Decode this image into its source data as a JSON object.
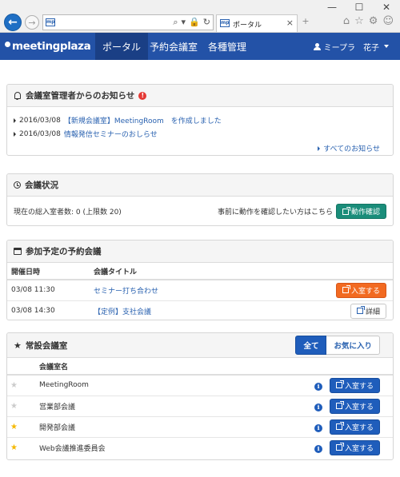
{
  "browser": {
    "favicon_text": "mp",
    "tab_title": "ポータル",
    "controls": {
      "minimize": "—",
      "maximize": "☐",
      "close": "✕"
    },
    "address_icons": [
      "⌕",
      "▾",
      "🔒",
      "↻"
    ],
    "new_tab": "+",
    "tools": [
      "⌂",
      "☆",
      "⚙",
      "☺"
    ]
  },
  "app": {
    "logo": "meetingplaza",
    "nav": [
      "ポータル",
      "予約会議室",
      "各種管理"
    ],
    "user": "ミープラ　花子"
  },
  "notices": {
    "title": "会議室管理者からのお知らせ",
    "alert": "!",
    "items": [
      {
        "date": "2016/03/08",
        "text": "【新規会議室】MeetingRoom　を作成しました"
      },
      {
        "date": "2016/03/08",
        "text": "情報発信セミナーのおしらせ"
      }
    ],
    "more": "すべてのお知らせ"
  },
  "status": {
    "title": "会議状況",
    "participants": "現在の総入室者数: 0 (上限数 20)",
    "check_prompt": "事前に動作を確認したい方はこちら",
    "check_button": "動作確認"
  },
  "upcoming": {
    "title": "参加予定の予約会議",
    "headers": [
      "開催日時",
      "会議タイトル"
    ],
    "rows": [
      {
        "datetime": "03/08 11:30",
        "title": "セミナー打ち合わせ",
        "action": "入室する"
      },
      {
        "datetime": "03/08 14:30",
        "title": "【定例】支社会議",
        "action": "詳細"
      }
    ]
  },
  "rooms": {
    "title": "常設会議室",
    "filters": [
      "全て",
      "お気に入り"
    ],
    "header": "会議室名",
    "info": "i",
    "rows": [
      {
        "name": "MeetingRoom",
        "favorite": false,
        "action": "入室する"
      },
      {
        "name": "営業部会議",
        "favorite": false,
        "action": "入室する"
      },
      {
        "name": "開発部会議",
        "favorite": true,
        "action": "入室する"
      },
      {
        "name": "Web会議推進委員会",
        "favorite": true,
        "action": "入室する"
      }
    ]
  },
  "colors": {
    "navbar": "#2352a7",
    "link": "#2a62b0",
    "teal": "#1a8d7a",
    "orange": "#f26a21",
    "blue_button": "#1f5dbb",
    "star_on": "#f5b800",
    "star_off": "#cccccc"
  }
}
